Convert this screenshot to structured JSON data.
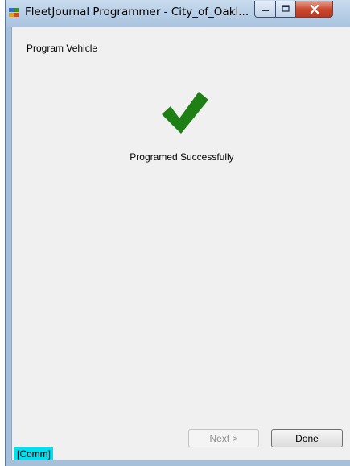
{
  "window": {
    "title": "FleetJournal Programmer - City_of_Oakl...",
    "app_icon": "app-window-icon",
    "controls": {
      "minimize": "minimize-icon",
      "maximize": "maximize-icon",
      "close": "close-icon"
    }
  },
  "content": {
    "step_title": "Program Vehicle",
    "success_icon": "checkmark-icon",
    "status_message": "Programed Successfully"
  },
  "buttons": {
    "next_label": "Next >",
    "done_label": "Done"
  },
  "status_bar": {
    "comm_label": "[Comm]"
  },
  "colors": {
    "check": "#1e7f14",
    "comm_bg": "#00e0f0"
  }
}
